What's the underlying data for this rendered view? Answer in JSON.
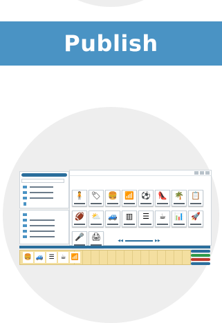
{
  "banner": {
    "label": "Publish"
  },
  "colors": {
    "banner": "#4a93c4",
    "accent": "#2a6e9c",
    "timeline": "#f4dfa0",
    "circle": "#eeeeee"
  },
  "tiles": [
    {
      "name": "person-icon",
      "glyph": "🧍"
    },
    {
      "name": "tag-icon",
      "glyph": "🏷"
    },
    {
      "name": "burger-icon",
      "glyph": "🍔"
    },
    {
      "name": "rss-icon",
      "glyph": "📶"
    },
    {
      "name": "soccer-ball-icon",
      "glyph": "⚽"
    },
    {
      "name": "high-heel-icon",
      "glyph": "👠"
    },
    {
      "name": "palm-tree-icon",
      "glyph": "🌴"
    },
    {
      "name": "checklist-icon",
      "glyph": "📋"
    },
    {
      "name": "football-icon",
      "glyph": "🏈"
    },
    {
      "name": "weather-icon",
      "glyph": "⛅"
    },
    {
      "name": "car-icon",
      "glyph": "🚙"
    },
    {
      "name": "barcode-icon",
      "glyph": "▥"
    },
    {
      "name": "list-icon",
      "glyph": "☰"
    },
    {
      "name": "coffee-cup-icon",
      "glyph": "☕"
    },
    {
      "name": "bar-chart-icon",
      "glyph": "📊"
    },
    {
      "name": "rocket-icon",
      "glyph": "🚀"
    },
    {
      "name": "microphone-icon",
      "glyph": "🎤"
    },
    {
      "name": "printer-icon",
      "glyph": "🖨"
    }
  ],
  "timeline": [
    {
      "name": "burger-icon",
      "glyph": "🍔"
    },
    {
      "name": "car-icon",
      "glyph": "🚙"
    },
    {
      "name": "list-icon",
      "glyph": "☰"
    },
    {
      "name": "coffee-cup-icon",
      "glyph": "☕"
    },
    {
      "name": "rss-icon",
      "glyph": "📶"
    }
  ],
  "pager": {
    "prev": "◀◀",
    "next": "▶▶"
  }
}
